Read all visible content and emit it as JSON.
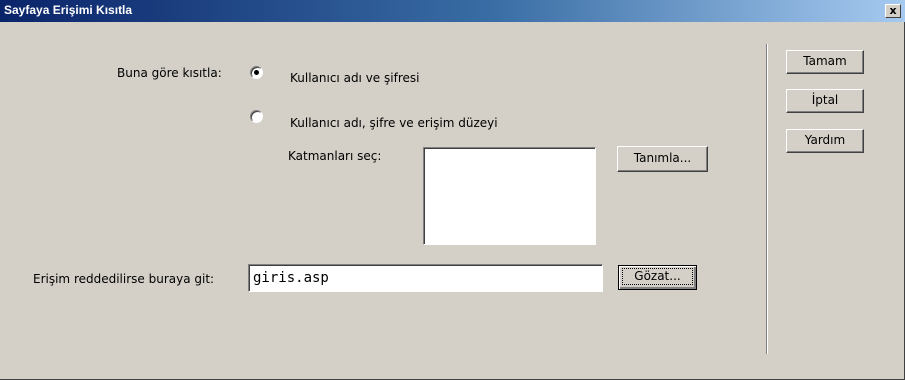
{
  "window": {
    "title": "Sayfaya Erişimi Kısıtla",
    "close_glyph": "x"
  },
  "restrict": {
    "label": "Buna göre kısıtla:",
    "options": [
      {
        "label": "Kullanıcı adı ve şifresi",
        "selected": true
      },
      {
        "label": "Kullanıcı adı, şifre ve erişim düzeyi",
        "selected": false
      }
    ]
  },
  "levels": {
    "label": "Katmanları seç:",
    "items": [],
    "define_button": "Tanımla..."
  },
  "redirect": {
    "label": "Erişim reddedilirse buraya git:",
    "value": "giris.asp",
    "browse_button": "Gözat..."
  },
  "actions": {
    "ok": "Tamam",
    "cancel": "İptal",
    "help": "Yardım"
  }
}
